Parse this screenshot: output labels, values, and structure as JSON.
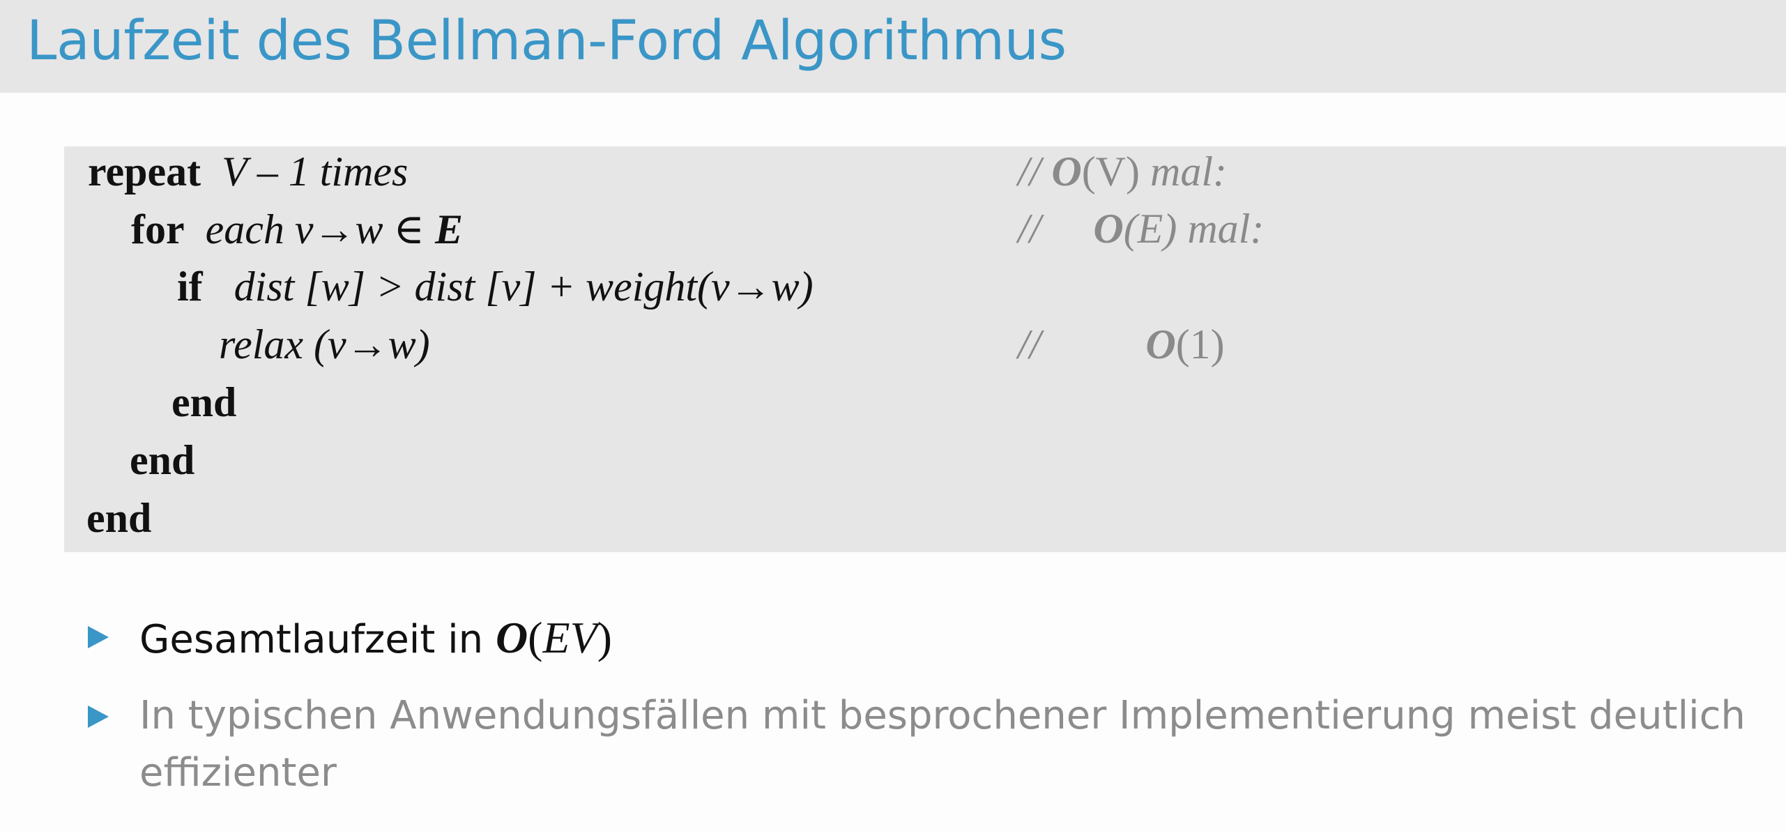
{
  "title": "Laufzeit des Bellman-Ford Algorithmus",
  "code": {
    "line1": {
      "kw": "repeat",
      "rest": "V – 1  times"
    },
    "line2": {
      "kw": "for",
      "rest": "each v→w ∈ ",
      "bold_var": "E"
    },
    "line3": {
      "kw": "if",
      "rest": "dist [w] > dist [v]  + weight(v→w)"
    },
    "line4": {
      "rest": "relax (v→w)"
    },
    "line5": {
      "kw": "end"
    },
    "line6": {
      "kw": "end"
    },
    "line7": {
      "kw": "end"
    }
  },
  "comments": {
    "c1": {
      "slash": "//",
      "big_o": "O",
      "arg": "(V)",
      "suffix": "mal:"
    },
    "c2": {
      "slash": "//",
      "big_o": "O",
      "arg": "(E)",
      "suffix": "mal:"
    },
    "c3": {
      "slash": "//",
      "big_o": "O",
      "arg": "(1)"
    }
  },
  "bullets": {
    "b1": {
      "text": "Gesamtlaufzeit in ",
      "big_o": "O",
      "lparen": "(",
      "arg": "EV",
      "rparen": ")"
    },
    "b2": {
      "line1": "In typischen Anwendungsfällen mit besprochener Implementierung meist deutlich",
      "line2": "effizienter"
    }
  },
  "colors": {
    "accent": "#3a96c7",
    "title_bar": "#e6e6e6",
    "code_bg": "#e6e6e6",
    "comment": "#8a8a8a"
  }
}
